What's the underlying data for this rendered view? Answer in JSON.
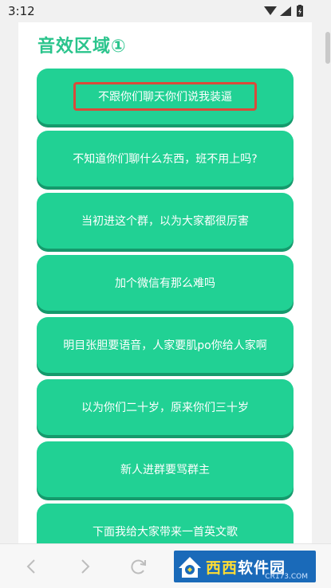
{
  "status_bar": {
    "time": "3:12"
  },
  "section": {
    "title": "音效区域①"
  },
  "sound_buttons": [
    {
      "label": "不跟你们聊天你们说我装逼"
    },
    {
      "label": "不知道你们聊什么东西，班不用上吗?"
    },
    {
      "label": "当初进这个群，以为大家都很厉害"
    },
    {
      "label": "加个微信有那么难吗"
    },
    {
      "label": "明目张胆要语音，人家要肌po你给人家啊"
    },
    {
      "label": "以为你们二十岁，原来你们三十岁"
    },
    {
      "label": "新人进群要骂群主"
    },
    {
      "label": "下面我给大家带来一首英文歌"
    }
  ],
  "bottom_nav": {
    "back_icon": "chevron-left-icon",
    "forward_icon": "chevron-right-icon",
    "reload_icon": "reload-icon"
  },
  "watermark": {
    "name_part1": "西西",
    "name_part2": "软件园",
    "domain": "CR173.COM"
  },
  "colors": {
    "accent": "#21d194",
    "button_shadow": "#159a6c",
    "title": "#2ac48c",
    "highlight_border": "#d94a3a",
    "watermark_bg": "#1a6ab9"
  }
}
